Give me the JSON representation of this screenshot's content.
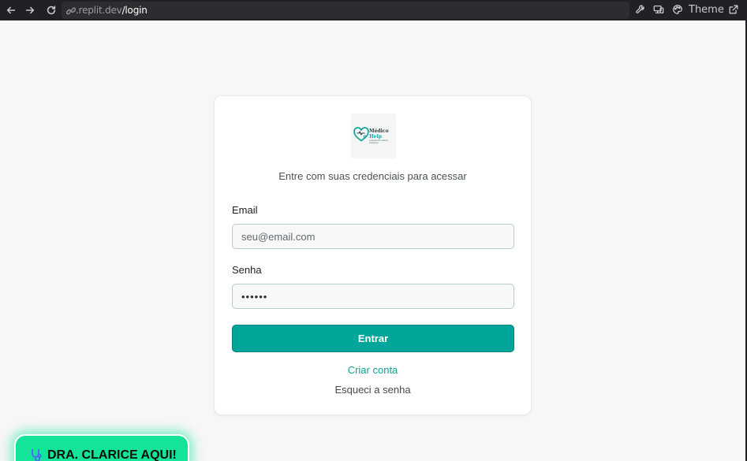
{
  "browser": {
    "url_domain": ".replit.dev",
    "url_path": "/login",
    "theme_label": "Theme",
    "icons": [
      "back-arrow-icon",
      "forward-arrow-icon",
      "reload-icon",
      "link-icon",
      "wrench-icon",
      "devices-icon",
      "palette-icon",
      "external-link-icon"
    ]
  },
  "logo": {
    "name_line1": "Médico",
    "name_line2": "Help",
    "tagline": "a plataforma médica inteligente"
  },
  "login": {
    "subtitle": "Entre com suas credenciais para acessar",
    "email_label": "Email",
    "email_placeholder": "seu@email.com",
    "password_label": "Senha",
    "password_value": "123456",
    "submit_label": "Entrar",
    "create_account_label": "Criar conta",
    "forgot_password_label": "Esqueci a senha"
  },
  "assistant": {
    "label": "DRA. CLARICE AQUI!",
    "icon": "stethoscope-icon"
  },
  "colors": {
    "primary": "#00a699",
    "link": "#12a094",
    "assistant_bg": "#14e39a",
    "chrome_bg": "#202124"
  }
}
